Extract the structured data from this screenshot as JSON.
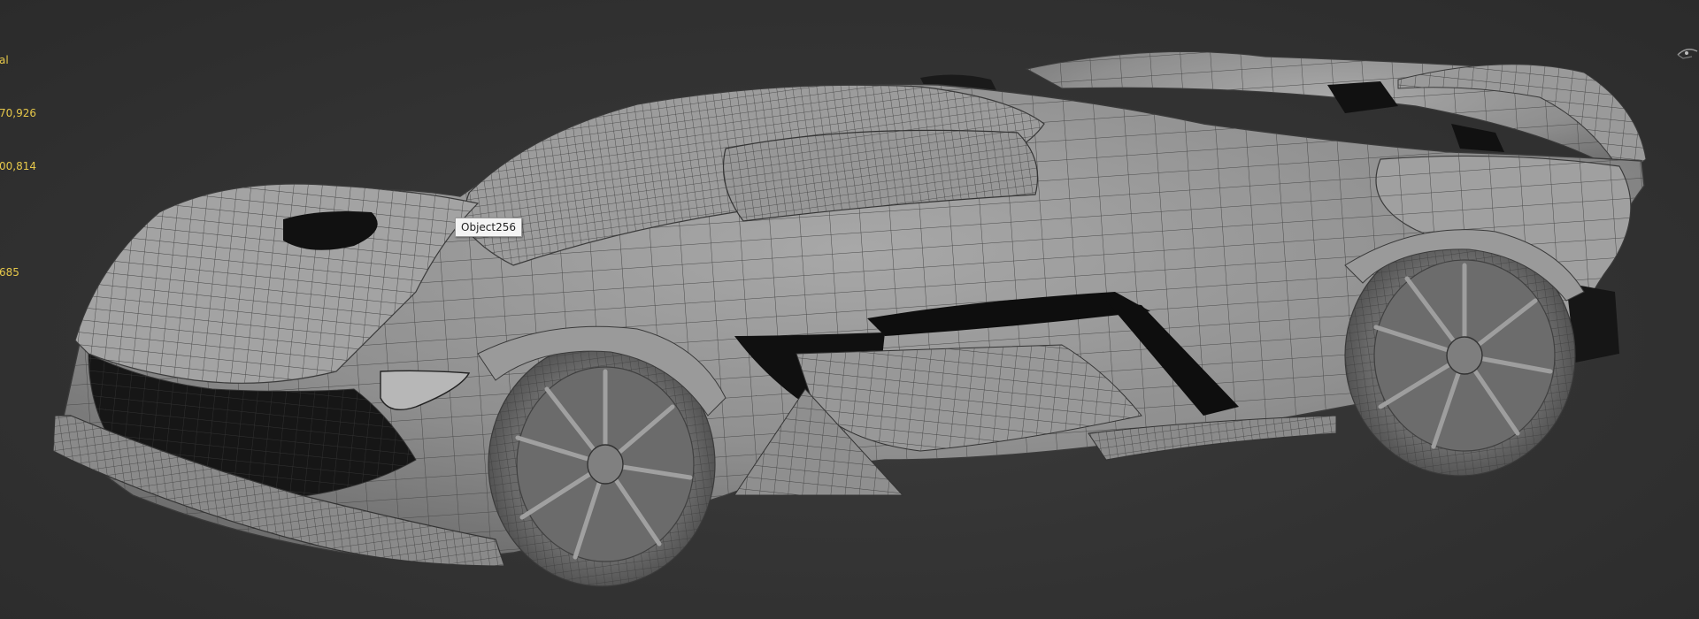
{
  "viewport": {
    "stats": {
      "line1": "al",
      "line2": "70,926",
      "line3": "00,814",
      "line4": "",
      "line5": "685"
    },
    "tooltip_label": "Object256"
  },
  "colors": {
    "background": "#333333",
    "stats_text": "#e6c84a",
    "mesh_fill": "#8e8e8e",
    "wire": "#3a3a3a",
    "tooltip_bg": "#f4f4f4"
  },
  "icons": {
    "view_gizmo": "viewcube-gizmo-icon"
  }
}
